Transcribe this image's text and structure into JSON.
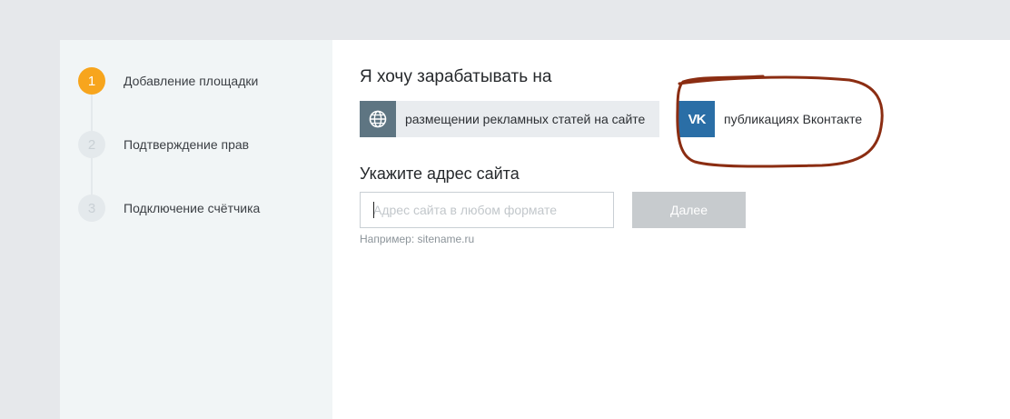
{
  "steps": [
    {
      "number": "1",
      "label": "Добавление площадки",
      "state": "active"
    },
    {
      "number": "2",
      "label": "Подтверждение прав",
      "state": "inactive"
    },
    {
      "number": "3",
      "label": "Подключение счётчика",
      "state": "inactive"
    }
  ],
  "main": {
    "earn_heading": "Я хочу зарабатывать на",
    "options": [
      {
        "label": "размещении рекламных статей на сайте",
        "icon": "globe-icon"
      },
      {
        "label": "публикациях Вконтакте",
        "icon": "vk-logo-icon",
        "icon_text": "VK"
      }
    ],
    "address_heading": "Укажите адрес сайта",
    "address_input": {
      "value": "",
      "placeholder": "Адрес сайта в любом формате"
    },
    "next_button": "Далее",
    "hint": "Например: sitename.ru"
  },
  "colors": {
    "page_background": "#e6e8eb",
    "sidebar_background": "#f1f5f6",
    "active_step": "#f7a51d",
    "inactive_step": "#e4e9ec",
    "site_icon_background": "#5e7582",
    "vk_icon_background": "#2a6ea6",
    "disabled_button": "#c7cbce",
    "annotation_stroke": "#8b2d12"
  }
}
